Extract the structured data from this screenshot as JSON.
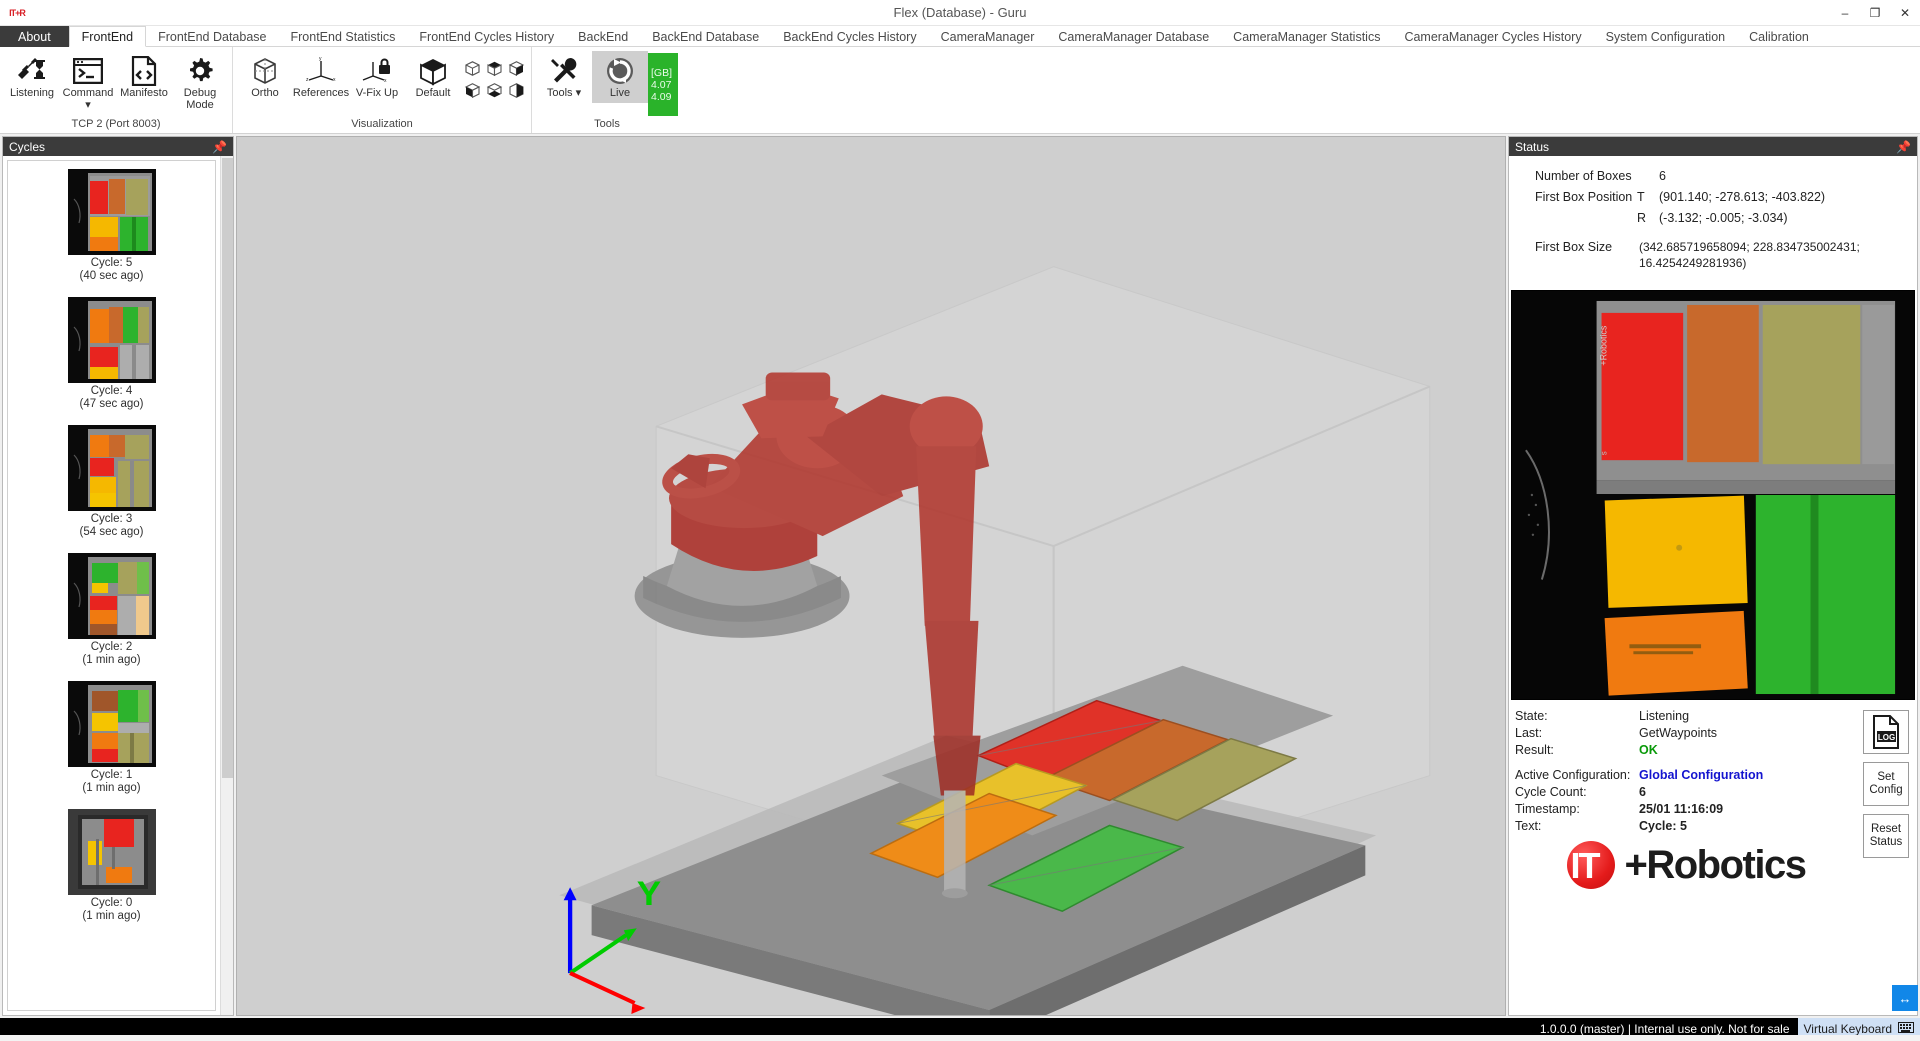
{
  "window": {
    "title": "Flex (Database)  - Guru",
    "app_icon": "it-robotics-icon",
    "minimize": "–",
    "maximize": "❐",
    "close": "✕"
  },
  "ribbon": {
    "tabs": [
      {
        "label": "About",
        "style": "about"
      },
      {
        "label": "FrontEnd",
        "style": "active"
      },
      {
        "label": "FrontEnd Database",
        "style": "normal"
      },
      {
        "label": "FrontEnd Statistics",
        "style": "normal"
      },
      {
        "label": "FrontEnd Cycles History",
        "style": "normal"
      },
      {
        "label": "BackEnd",
        "style": "normal"
      },
      {
        "label": "BackEnd Database",
        "style": "normal"
      },
      {
        "label": "BackEnd Cycles History",
        "style": "normal"
      },
      {
        "label": "CameraManager",
        "style": "normal"
      },
      {
        "label": "CameraManager Database",
        "style": "normal"
      },
      {
        "label": "CameraManager Statistics",
        "style": "normal"
      },
      {
        "label": "CameraManager Cycles History",
        "style": "normal"
      },
      {
        "label": "System Configuration",
        "style": "normal"
      },
      {
        "label": "Calibration",
        "style": "normal"
      }
    ],
    "groups": [
      {
        "title": "TCP 2 (Port 8003)",
        "buttons": [
          {
            "label": "Listening",
            "icon": "plug-hourglass-icon"
          },
          {
            "label": "Command ▾",
            "icon": "console-icon"
          },
          {
            "label": "Manifesto",
            "icon": "code-file-icon"
          },
          {
            "label": "Debug Mode",
            "icon": "gear-icon"
          }
        ]
      },
      {
        "title": "Visualization",
        "buttons": [
          {
            "label": "Ortho",
            "icon": "wireframe-cube-icon"
          },
          {
            "label": "References",
            "icon": "axes-icon"
          },
          {
            "label": "V-Fix Up",
            "icon": "axes-lock-icon"
          },
          {
            "label": "Default",
            "icon": "solid-cube-icon"
          }
        ],
        "small_buttons": [
          {
            "icon": "cube-view-top-left-icon"
          },
          {
            "icon": "cube-view-top-icon"
          },
          {
            "icon": "cube-view-top-right-icon"
          },
          {
            "icon": "cube-view-left-icon"
          },
          {
            "icon": "cube-view-bottom-icon"
          },
          {
            "icon": "cube-view-right-icon"
          }
        ]
      },
      {
        "title": "Tools",
        "buttons": [
          {
            "label": "Tools ▾",
            "icon": "wrench-screwdriver-icon"
          },
          {
            "label": "Live",
            "icon": "refresh-circle-icon",
            "state": "pressed"
          }
        ],
        "memory_chip": {
          "unit": "[GB]",
          "used": "4.07",
          "total": "4.09",
          "color": "#2ab32a"
        }
      }
    ]
  },
  "cycles_panel": {
    "title": "Cycles",
    "pin_icon": "pin-icon",
    "items": [
      {
        "label": "Cycle: 5",
        "time": "(40 sec ago)",
        "thumb": "cycle-5-thumb"
      },
      {
        "label": "Cycle: 4",
        "time": "(47 sec ago)",
        "thumb": "cycle-4-thumb"
      },
      {
        "label": "Cycle: 3",
        "time": "(54 sec ago)",
        "thumb": "cycle-3-thumb"
      },
      {
        "label": "Cycle: 2",
        "time": "(1 min ago)",
        "thumb": "cycle-2-thumb"
      },
      {
        "label": "Cycle: 1",
        "time": "(1 min ago)",
        "thumb": "cycle-1-thumb"
      },
      {
        "label": "Cycle: 0",
        "time": "(1 min ago)",
        "thumb": "cycle-0-thumb"
      }
    ]
  },
  "viewport": {
    "axis_label_y": "Y",
    "axis_colors": {
      "x": "#ff0000",
      "y": "#00cc00",
      "z": "#0000ff"
    }
  },
  "status_panel": {
    "title": "Status",
    "pin_icon": "pin-icon",
    "fields": {
      "number_of_boxes_label": "Number of Boxes",
      "number_of_boxes_value": "6",
      "first_box_position_label": "First Box Position",
      "position_t_key": "T",
      "position_t_value": "(901.140; -278.613; -403.822)",
      "position_r_key": "R",
      "position_r_value": "(-3.132; -0.005; -3.034)",
      "first_box_size_label": "First Box Size",
      "first_box_size_value": "(342.685719658094; 228.834735002431; 16.4254249281936)"
    },
    "details": {
      "state_label": "State:",
      "state_value": "Listening",
      "last_label": "Last:",
      "last_value": "GetWaypoints",
      "result_label": "Result:",
      "result_value": "OK",
      "active_config_label": "Active Configuration:",
      "active_config_value": "Global Configuration",
      "cycle_count_label": "Cycle Count:",
      "cycle_count_value": "6",
      "timestamp_label": "Timestamp:",
      "timestamp_value": "25/01 11:16:09",
      "text_label": "Text:",
      "text_value": "Cycle: 5"
    },
    "buttons": [
      {
        "label": "LOG",
        "name": "log-button",
        "icon": "log-file-icon"
      },
      {
        "label": "Set Config",
        "name": "set-config-button"
      },
      {
        "label": "Reset Status",
        "name": "reset-status-button"
      }
    ],
    "brand": {
      "mark": "IT",
      "text": "+Robotics"
    }
  },
  "bottom_bar": {
    "version_text": "1.0.0.0 (master) | Internal use only. Not for sale",
    "virtual_keyboard_label": "Virtual Keyboard",
    "keyboard_icon": "keyboard-icon",
    "teamviewer_icon": "teamviewer-icon"
  },
  "colors": {
    "accent_green": "#2ab32a",
    "config_blue": "#1414cf",
    "ok_green": "#0a9a0a",
    "header_dark": "#3b3b3b",
    "brand_red": "#e41b1b"
  }
}
